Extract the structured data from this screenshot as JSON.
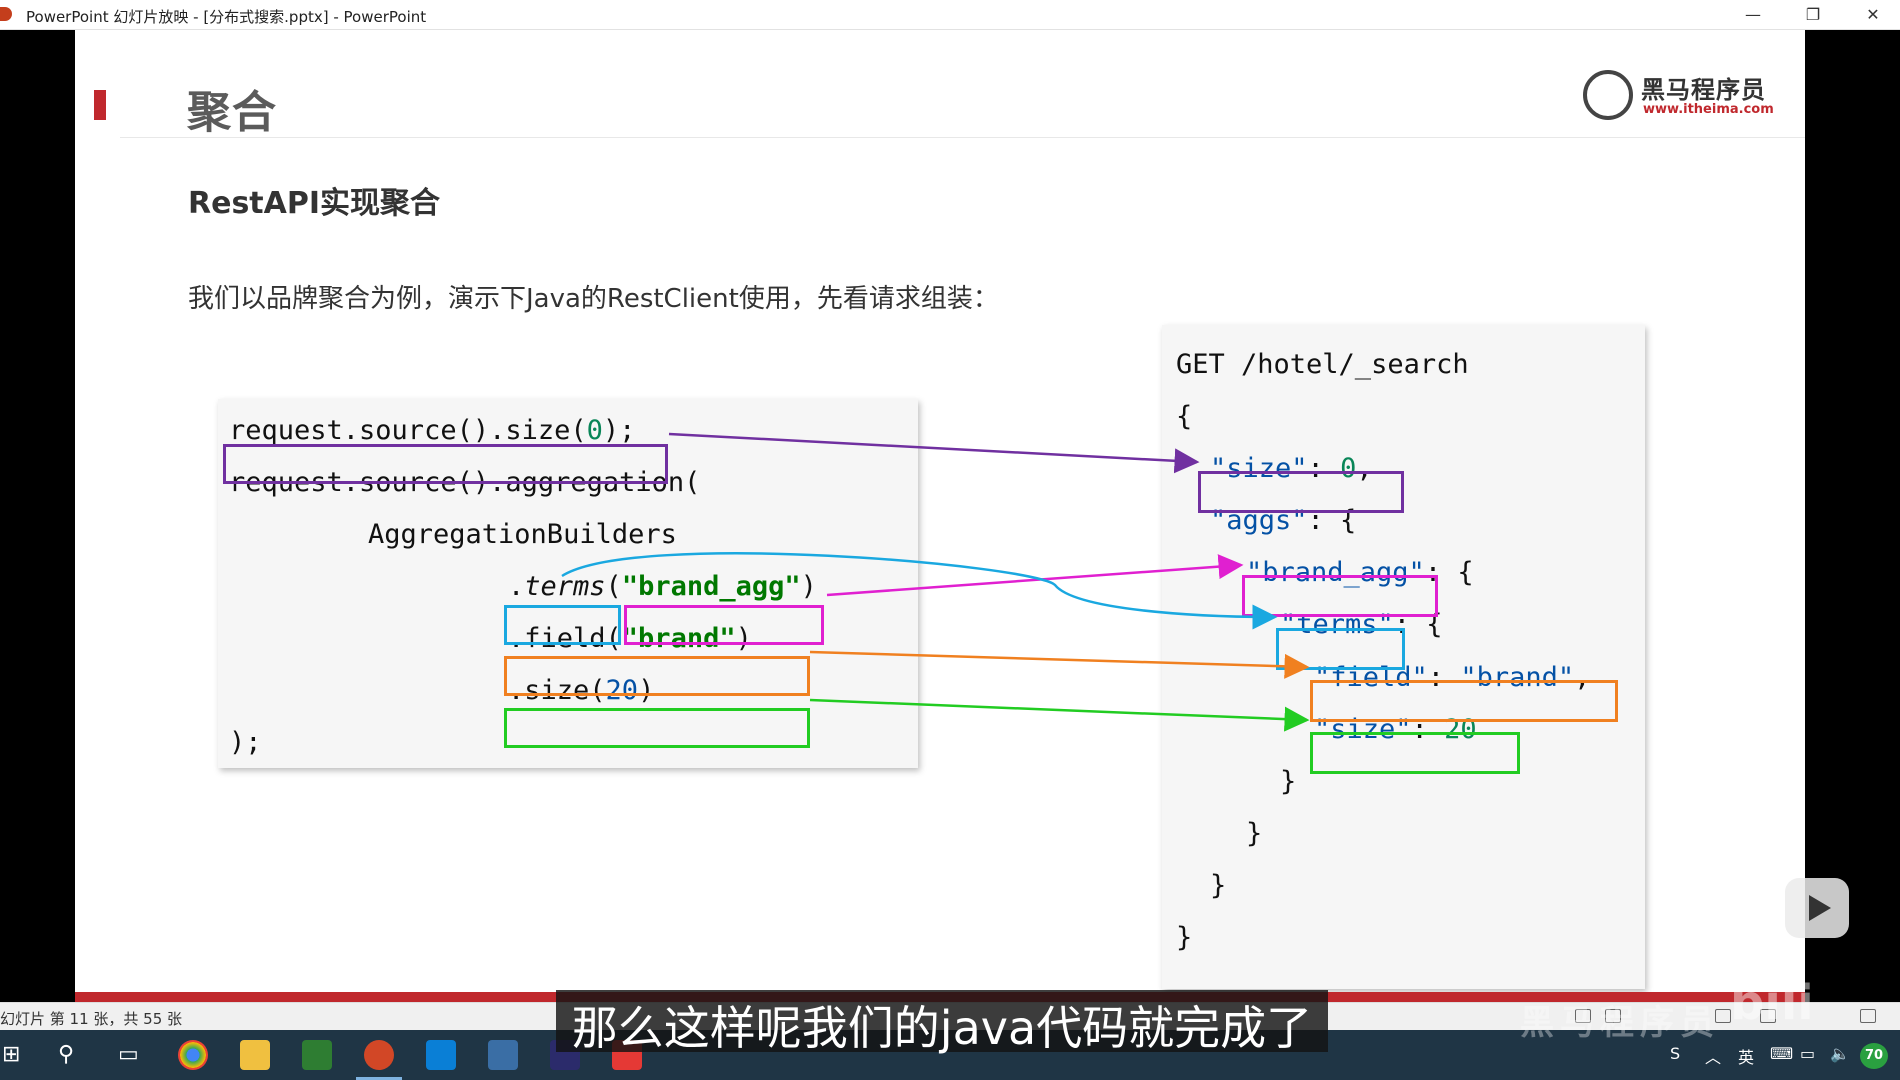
{
  "window": {
    "title": "PowerPoint 幻灯片放映 - [分布式搜索.pptx] - PowerPoint",
    "minimize": "—",
    "restore": "❐",
    "close": "✕"
  },
  "slide": {
    "title": "聚合",
    "subheading": "RestAPI实现聚合",
    "intro": "我们以品牌聚合为例，演示下Java的RestClient使用，先看请求组装：",
    "logo": {
      "name": "黑马程序员",
      "url": "www.itheima.com"
    },
    "java_code": {
      "line1": "request.source().size(",
      "line1_num": "0",
      "line1_end": ");",
      "line2": "request.source().aggregation(",
      "line3": "AggregationBuilders",
      "line4_dot": ".",
      "line4_method": "terms",
      "line4_open": "(",
      "line4_arg": "\"brand_agg\"",
      "line4_close": ")",
      "line5": ".field(",
      "line5_arg": "\"brand\"",
      "line5_close": ")",
      "line6": ".size(",
      "line6_num": "20",
      "line6_close": ")",
      "line7": ");"
    },
    "dsl_code": {
      "line1": "GET /hotel/_search",
      "open": "{",
      "size_key": "\"size\"",
      "size_sep": ": ",
      "size_val": "0",
      "size_comma": ",",
      "aggs_key": "\"aggs\"",
      "aggs_open": ": {",
      "brand_agg_key": "\"brand_agg\"",
      "brand_agg_open": ": {",
      "terms_key": "\"terms\"",
      "terms_open": ": {",
      "field_key": "\"field\"",
      "field_sep": ": ",
      "field_val": "\"brand\"",
      "field_comma": ",",
      "size2_key": "\"size\"",
      "size2_sep": ": ",
      "size2_val": "20",
      "close": "}"
    }
  },
  "statusbar": {
    "text": "幻灯片 第 11 张，共 55 张"
  },
  "subtitle": "那么这样呢我们的java代码就完成了",
  "watermark": {
    "text": "黑马程序员",
    "brand": "bili"
  },
  "taskbar": {
    "ime": "英",
    "battery": "70"
  },
  "colors": {
    "accent": "#c0282d",
    "purple": "#7030a0",
    "magenta": "#e020d0",
    "cyan": "#1aa8e0",
    "orange": "#f08020",
    "green": "#22cc22"
  }
}
